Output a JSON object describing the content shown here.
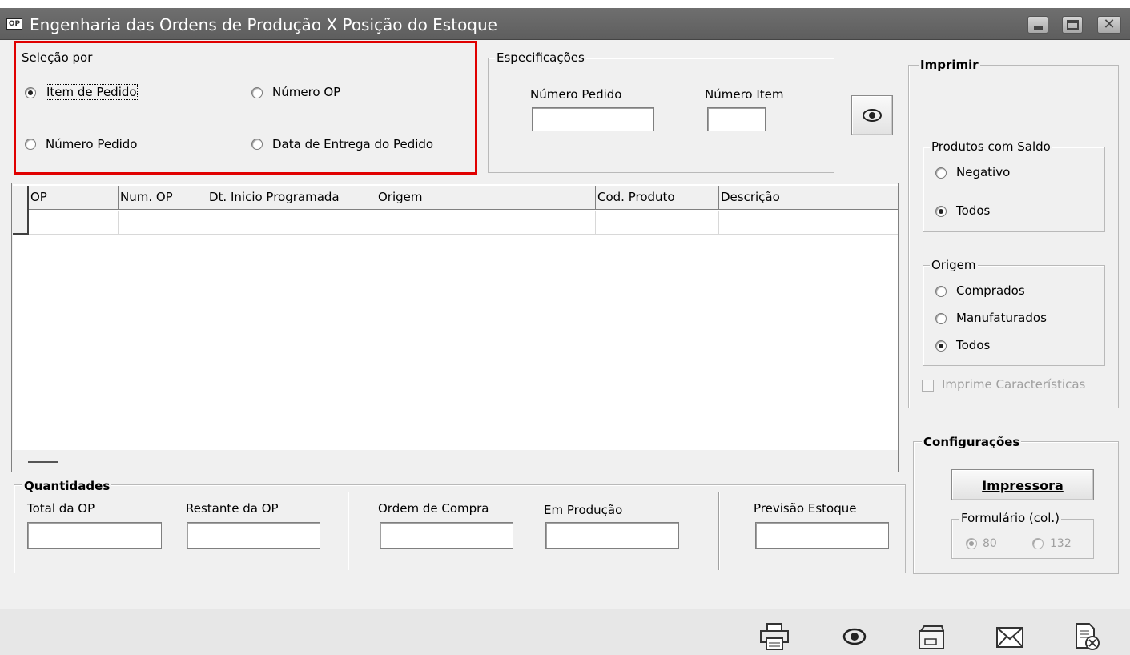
{
  "window": {
    "title": "Engenharia das Ordens de Produção X Posição do Estoque",
    "icon_text": "OP"
  },
  "selecao": {
    "label": "Seleção por",
    "options": [
      {
        "label": "Item de Pedido",
        "checked": true
      },
      {
        "label": "Número OP",
        "checked": false
      },
      {
        "label": "Número Pedido",
        "checked": false
      },
      {
        "label": "Data de Entrega do Pedido",
        "checked": false
      }
    ]
  },
  "especificacoes": {
    "label": "Especificações",
    "numero_pedido_label": "Número Pedido",
    "numero_pedido_value": "",
    "numero_item_label": "Número Item",
    "numero_item_value": ""
  },
  "grid": {
    "columns": [
      "OP",
      "Num. OP",
      "Dt. Inicio Programada",
      "Origem",
      "Cod. Produto",
      "Descrição"
    ]
  },
  "quantidades": {
    "label": "Quantidades",
    "total_op": "Total da OP",
    "restante_op": "Restante da OP",
    "ordem_compra": "Ordem de Compra",
    "em_producao": "Em Produção",
    "previsao_estoque": "Previsão Estoque"
  },
  "imprimir": {
    "label": "Imprimir",
    "produtos_saldo": {
      "label": "Produtos com Saldo",
      "options": [
        {
          "label": "Negativo",
          "checked": false
        },
        {
          "label": "Todos",
          "checked": true
        }
      ]
    },
    "origem": {
      "label": "Origem",
      "options": [
        {
          "label": "Comprados",
          "checked": false
        },
        {
          "label": "Manufaturados",
          "checked": false
        },
        {
          "label": "Todos",
          "checked": true
        }
      ]
    },
    "imprime_caracteristicas": "Imprime Características"
  },
  "configuracoes": {
    "label": "Configurações",
    "impressora_button": "Impressora",
    "formulario": {
      "label": "Formulário (col.)",
      "options": [
        {
          "label": "80",
          "checked": true
        },
        {
          "label": "132",
          "checked": false
        }
      ]
    }
  },
  "toolbar": {
    "icons": [
      "printer-icon",
      "preview-eye-icon",
      "folder-icon",
      "email-icon",
      "close-document-icon"
    ]
  },
  "colors": {
    "titlebar": "#666666",
    "highlight_border": "#e00000",
    "background": "#f0f0f0"
  }
}
